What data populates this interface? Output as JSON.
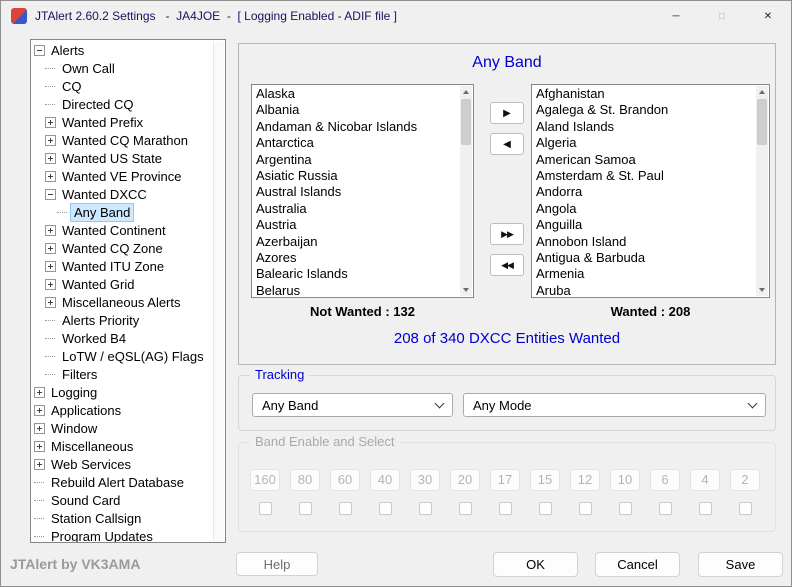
{
  "colors": {
    "accent_blue": "#0000cd",
    "title_text": "#14145f",
    "selection": "#cde8ff"
  },
  "window": {
    "title": "JTAlert 2.60.2 Settings   -  JA4JOE  -  [ Logging Enabled - ADIF file ]",
    "controls": {
      "minimize_icon": "─",
      "maximize_icon": "□",
      "close_icon": "✕"
    }
  },
  "tree": {
    "items": [
      {
        "label": "Alerts",
        "level": 0,
        "exp": "minus"
      },
      {
        "label": "Own Call",
        "level": 1,
        "exp": "none"
      },
      {
        "label": "CQ",
        "level": 1,
        "exp": "none"
      },
      {
        "label": "Directed CQ",
        "level": 1,
        "exp": "none"
      },
      {
        "label": "Wanted Prefix",
        "level": 1,
        "exp": "plus"
      },
      {
        "label": "Wanted CQ Marathon",
        "level": 1,
        "exp": "plus"
      },
      {
        "label": "Wanted US State",
        "level": 1,
        "exp": "plus"
      },
      {
        "label": "Wanted VE Province",
        "level": 1,
        "exp": "plus"
      },
      {
        "label": "Wanted DXCC",
        "level": 1,
        "exp": "minus"
      },
      {
        "label": "Any Band",
        "level": 2,
        "exp": "none",
        "sel": true
      },
      {
        "label": "Wanted Continent",
        "level": 1,
        "exp": "plus"
      },
      {
        "label": "Wanted CQ Zone",
        "level": 1,
        "exp": "plus"
      },
      {
        "label": "Wanted ITU Zone",
        "level": 1,
        "exp": "plus"
      },
      {
        "label": "Wanted Grid",
        "level": 1,
        "exp": "plus"
      },
      {
        "label": "Miscellaneous Alerts",
        "level": 1,
        "exp": "plus"
      },
      {
        "label": "Alerts Priority",
        "level": 1,
        "exp": "none"
      },
      {
        "label": "Worked B4",
        "level": 1,
        "exp": "none"
      },
      {
        "label": "LoTW / eQSL(AG) Flags",
        "level": 1,
        "exp": "none"
      },
      {
        "label": "Filters",
        "level": 1,
        "exp": "none"
      },
      {
        "label": "Logging",
        "level": 0,
        "exp": "plus"
      },
      {
        "label": "Applications",
        "level": 0,
        "exp": "plus"
      },
      {
        "label": "Window",
        "level": 0,
        "exp": "plus"
      },
      {
        "label": "Miscellaneous",
        "level": 0,
        "exp": "plus"
      },
      {
        "label": "Web Services",
        "level": 0,
        "exp": "plus"
      },
      {
        "label": "Rebuild Alert Database",
        "level": 0,
        "exp": "none"
      },
      {
        "label": "Sound Card",
        "level": 0,
        "exp": "none"
      },
      {
        "label": "Station Callsign",
        "level": 0,
        "exp": "none"
      },
      {
        "label": "Program Updates",
        "level": 0,
        "exp": "none"
      }
    ]
  },
  "dxcc": {
    "title": "Any Band",
    "not_wanted": {
      "items": [
        "Alaska",
        "Albania",
        "Andaman & Nicobar Islands",
        "Antarctica",
        "Argentina",
        "Asiatic Russia",
        "Austral Islands",
        "Australia",
        "Austria",
        "Azerbaijan",
        "Azores",
        "Balearic Islands",
        "Belarus"
      ],
      "count_label": "Not Wanted : 132"
    },
    "wanted": {
      "items": [
        "Afghanistan",
        "Agalega & St. Brandon",
        "Aland Islands",
        "Algeria",
        "American Samoa",
        "Amsterdam & St. Paul",
        "Andorra",
        "Angola",
        "Anguilla",
        "Annobon Island",
        "Antigua & Barbuda",
        "Armenia",
        "Aruba"
      ],
      "count_label": "Wanted : 208"
    },
    "summary": "208 of 340 DXCC Entities Wanted",
    "move_icons": {
      "right": "▶",
      "left": "◀",
      "all_right": "▶▶",
      "all_left": "◀◀"
    }
  },
  "tracking": {
    "legend": "Tracking",
    "band_value": "Any Band",
    "mode_value": "Any Mode"
  },
  "bands": {
    "legend": "Band Enable and Select",
    "items": [
      "160",
      "80",
      "60",
      "40",
      "30",
      "20",
      "17",
      "15",
      "12",
      "10",
      "6",
      "4",
      "2"
    ]
  },
  "footer": {
    "status": "JTAlert by VK3AMA",
    "help": "Help",
    "ok": "OK",
    "cancel": "Cancel",
    "save": "Save"
  }
}
